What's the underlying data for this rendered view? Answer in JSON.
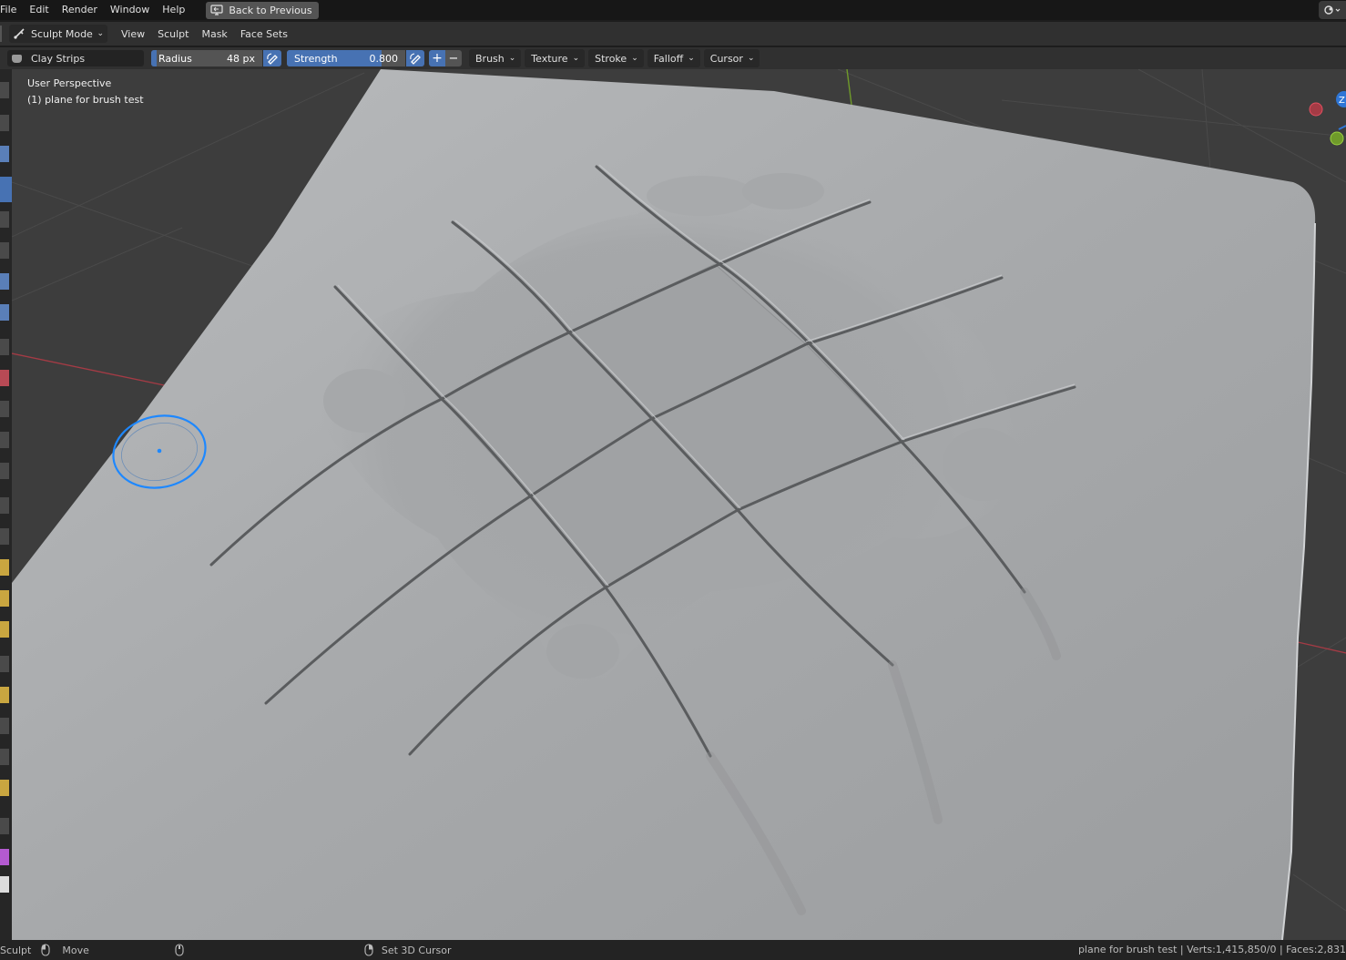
{
  "menu": {
    "items": [
      "File",
      "Edit",
      "Render",
      "Window",
      "Help"
    ],
    "back_button": "Back to Previous"
  },
  "header": {
    "mode": "Sculpt Mode",
    "menus": [
      "View",
      "Sculpt",
      "Mask",
      "Face Sets"
    ]
  },
  "toolbar": {
    "brush_name": "Clay Strips",
    "radius_label": "Radius",
    "radius_value": "48 px",
    "strength_label": "Strength",
    "strength_value": "0.800",
    "strength_fraction": 0.8,
    "plus": "+",
    "minus": "−",
    "dropdowns": [
      "Brush",
      "Texture",
      "Stroke",
      "Falloff",
      "Cursor"
    ]
  },
  "viewport": {
    "perspective": "User Perspective",
    "object_label": "(1) plane for brush test",
    "gizmo_z": "Z"
  },
  "status": {
    "left_label": "Sculpt",
    "move": "Move",
    "set_cursor": "Set 3D Cursor",
    "stats": "plane for brush test | Verts:1,415,850/0 | Faces:2,831"
  },
  "colors": {
    "accent": "#4772b3",
    "brush_cursor": "#1e88ff",
    "mesh": "#a9abad",
    "background": "#3d3d3d",
    "x_axis": "#a43b45",
    "y_axis": "#6f9a2a"
  }
}
